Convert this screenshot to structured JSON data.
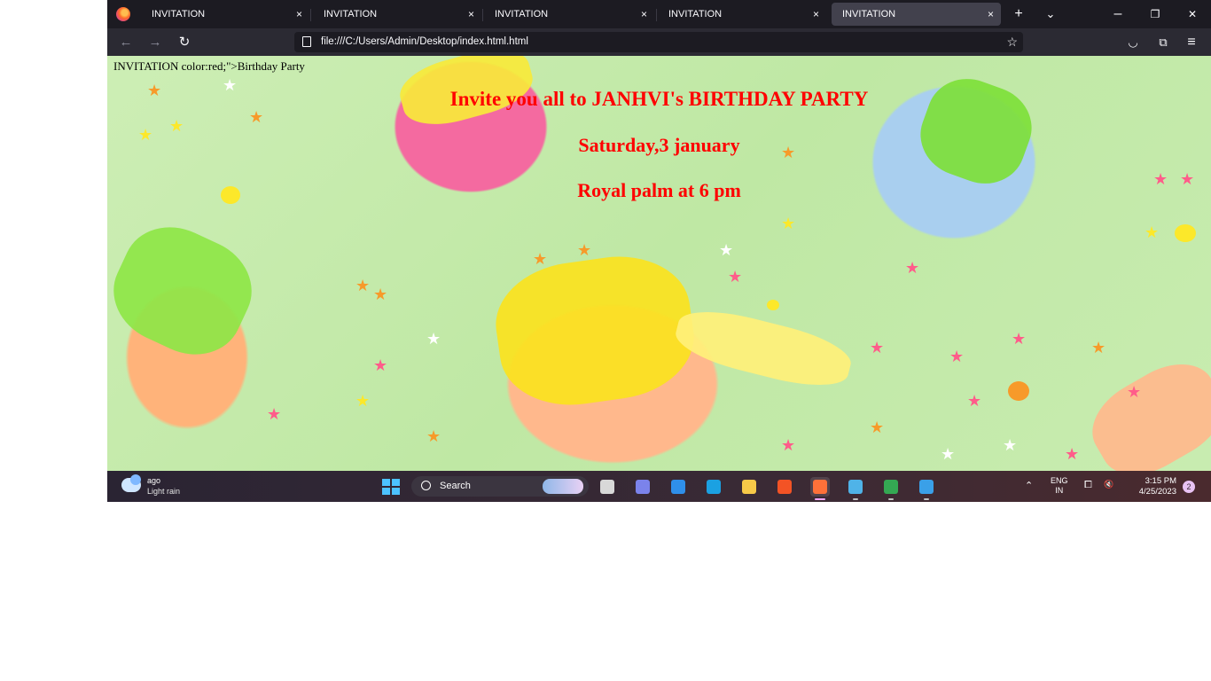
{
  "browser": {
    "tabs": [
      {
        "label": "INVITATION",
        "active": false
      },
      {
        "label": "INVITATION",
        "active": false
      },
      {
        "label": "INVITATION",
        "active": false
      },
      {
        "label": "INVITATION",
        "active": false
      },
      {
        "label": "INVITATION",
        "active": true
      }
    ],
    "tab_close_glyph": "×",
    "new_tab_glyph": "+",
    "list_tabs_glyph": "⌄",
    "window_controls": {
      "minimize": "–",
      "restore": "❐",
      "close": "✕"
    },
    "nav": {
      "back": "←",
      "forward": "→",
      "reload": "↻"
    },
    "url": "file:///C:/Users/Admin/Desktop/index.html.html",
    "bookmark_glyph": "☆",
    "toolbar_right": {
      "pocket": "◡",
      "extensions": "⧉",
      "menu": "≡"
    }
  },
  "page": {
    "raw_text": "INVITATION color:red;\">Birthday Party",
    "lines": [
      "Invite you all to JANHVI's BIRTHDAY PARTY",
      "Saturday,3 january",
      "Royal palm at 6 pm"
    ],
    "text_color": "#ff0000",
    "background_image": "gift-boxes-with-bows-and-confetti-stars"
  },
  "taskbar": {
    "weather": {
      "temp": "ago",
      "condition": "Light rain",
      "icon": "cloud-rain-icon"
    },
    "search_label": "Search",
    "apps": [
      {
        "name": "task-view-icon",
        "color": "#d8d8d8",
        "running": false
      },
      {
        "name": "teams-chat-icon",
        "color": "#7b83eb",
        "running": false
      },
      {
        "name": "mail-icon",
        "color": "#2f8fea",
        "running": false
      },
      {
        "name": "edge-icon",
        "color": "#1ba1e2",
        "running": false
      },
      {
        "name": "file-explorer-icon",
        "color": "#f7c948",
        "running": false
      },
      {
        "name": "microsoft-store-icon",
        "color": "#f35325",
        "running": false
      },
      {
        "name": "firefox-icon",
        "color": "#ff7139",
        "running": true
      },
      {
        "name": "notepad-icon",
        "color": "#4fb3e8",
        "running": false
      },
      {
        "name": "chrome-icon",
        "color": "#34a853",
        "running": false
      },
      {
        "name": "paint-icon",
        "color": "#3aa0e8",
        "running": false
      }
    ],
    "tray": {
      "chevron": "⌃",
      "lang_top": "ENG",
      "lang_bottom": "IN",
      "network_glyph": "⧠",
      "volume_glyph": "🔇",
      "time": "3:15 PM",
      "date": "4/25/2023",
      "notification_count": "2"
    }
  }
}
